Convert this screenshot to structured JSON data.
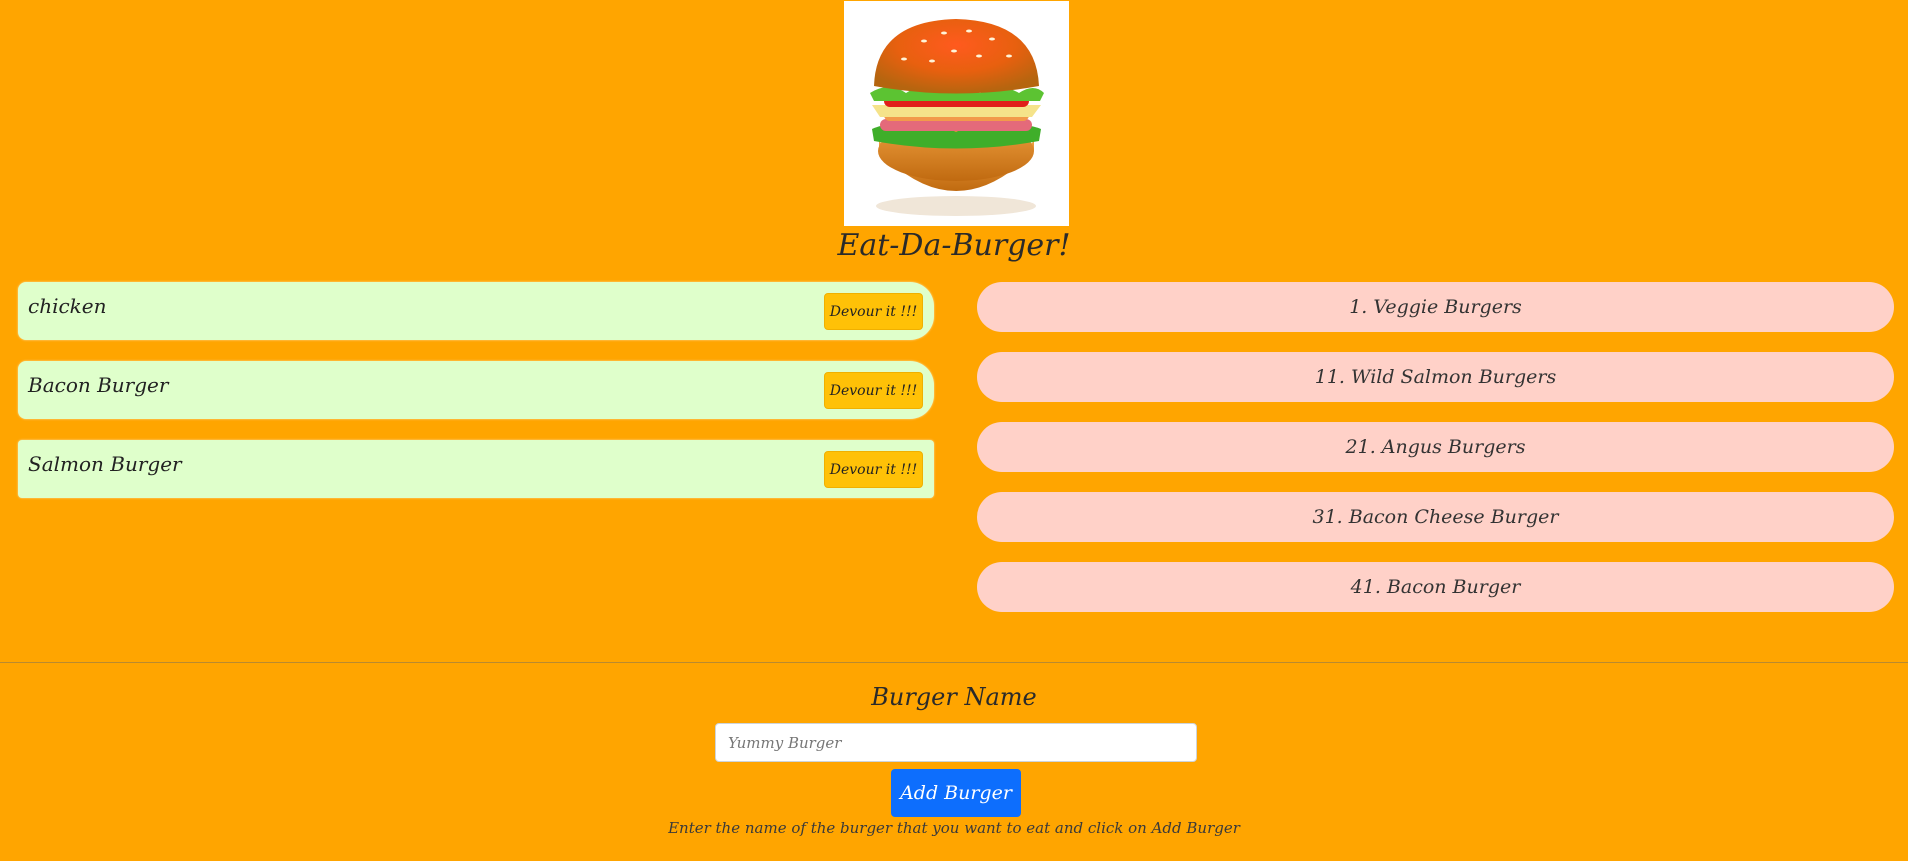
{
  "header": {
    "logo_icon": "burger-illustration",
    "title": "Eat-Da-Burger!"
  },
  "to_eat": [
    {
      "name": "chicken",
      "button_label": "Devour it !!!"
    },
    {
      "name": "Bacon Burger",
      "button_label": "Devour it !!!"
    },
    {
      "name": "Salmon Burger",
      "button_label": "Devour it !!!"
    }
  ],
  "eaten": [
    {
      "label": "1. Veggie Burgers"
    },
    {
      "label": "11. Wild Salmon Burgers"
    },
    {
      "label": "21. Angus Burgers"
    },
    {
      "label": "31. Bacon Cheese Burger"
    },
    {
      "label": "41. Bacon Burger"
    }
  ],
  "form": {
    "label": "Burger Name",
    "placeholder": "Yummy Burger",
    "value": "",
    "submit_label": "Add Burger",
    "help_text": "Enter the name of the burger that you want to eat and click on Add Burger"
  },
  "colors": {
    "background": "#FFA500",
    "to_eat_bg": "#DFFFCB",
    "eaten_bg": "#FFD1C8",
    "devour_button": "#FFC107",
    "primary_button": "#0D6EFD"
  }
}
